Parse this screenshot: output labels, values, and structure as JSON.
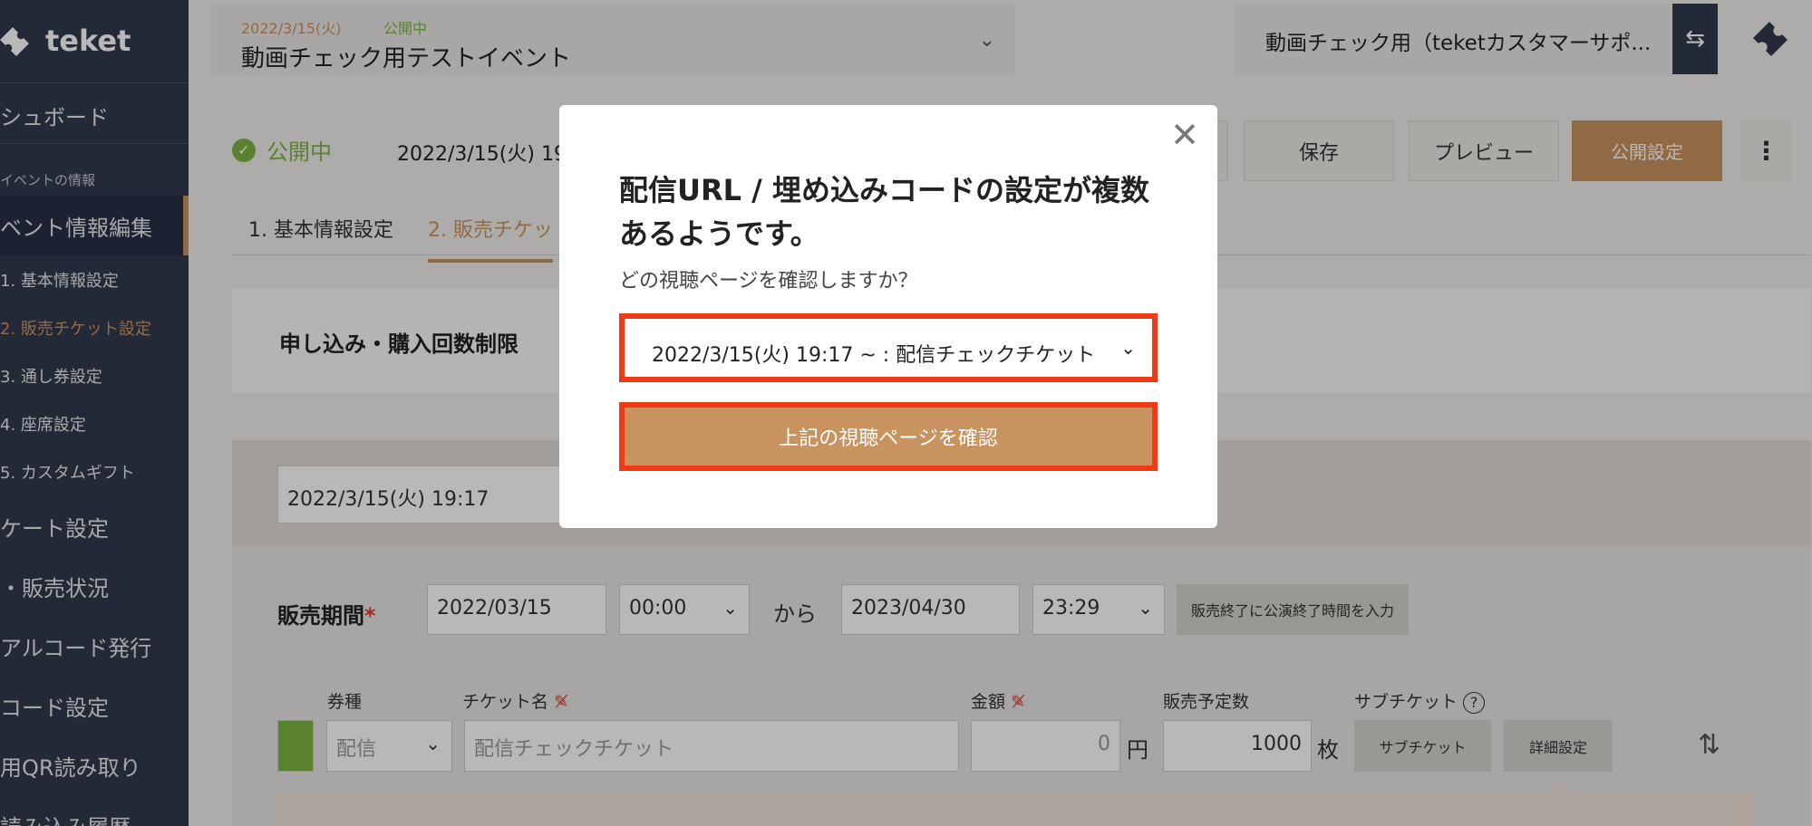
{
  "sidebar": {
    "logo": "teket",
    "items": [
      {
        "label": "シュボード"
      },
      {
        "label": "イベントの情報"
      },
      {
        "label": "ベント情報編集"
      },
      {
        "label": "1. 基本情報設定"
      },
      {
        "label": "2. 販売チケット設定"
      },
      {
        "label": "3. 通し券設定"
      },
      {
        "label": "4. 座席設定"
      },
      {
        "label": "5. カスタムギフト"
      },
      {
        "label": "ケート設定"
      },
      {
        "label": "・販売状況"
      },
      {
        "label": "アルコード発行"
      },
      {
        "label": "コード設定"
      },
      {
        "label": "用QR読み取り"
      },
      {
        "label": "読み込み履歴"
      }
    ]
  },
  "header": {
    "event_date": "2022/3/15(火)",
    "event_status": "公開中",
    "event_title": "動画チェック用テストイベント",
    "org_name": "動画チェック用（teketカスタマーサポ..."
  },
  "status_row": {
    "status": "公開中",
    "date": "2022/3/15(火) 19"
  },
  "toolbar": {
    "save": "保存",
    "preview": "プレビュー",
    "publish": "公開設定"
  },
  "tabs": [
    {
      "label": "1. 基本情報設定"
    },
    {
      "label": "2. 販売チケッ"
    }
  ],
  "limit_card": {
    "label": "申し込み・購入回数制限"
  },
  "performance": {
    "date": "2022/3/15(火) 19:17",
    "sale_period_label": "販売期間",
    "required_mark": "*",
    "start_date": "2022/03/15",
    "start_time": "00:00",
    "kara": "から",
    "end_date": "2023/04/30",
    "end_time": "23:29",
    "end_btn": "販売終了に公演終了時間を入力"
  },
  "ticket_table": {
    "headers": {
      "type": "券種",
      "name": "チケット名",
      "price": "金額",
      "quantity": "販売予定数",
      "sub": "サブチケット"
    },
    "row": {
      "type": "配信",
      "name_placeholder": "配信チェックチケット",
      "price": "0",
      "yen": "円",
      "quantity": "1000",
      "mai": "枚",
      "sub_btn": "サブチケット",
      "detail_btn": "詳細設定"
    }
  },
  "modal": {
    "title": "配信URL / 埋め込みコードの設定が複数あるようです。",
    "question": "どの視聴ページを確認しますか？",
    "selected_option": "2022/3/15(火) 19:17 ~ : 配信チェックチケット",
    "confirm": "上記の視聴ページを確認"
  },
  "colors": {
    "accent": "#c8935f",
    "sidebar_bg": "#333a4d",
    "status_green": "#7cb342",
    "highlight_red": "#f03a17"
  }
}
